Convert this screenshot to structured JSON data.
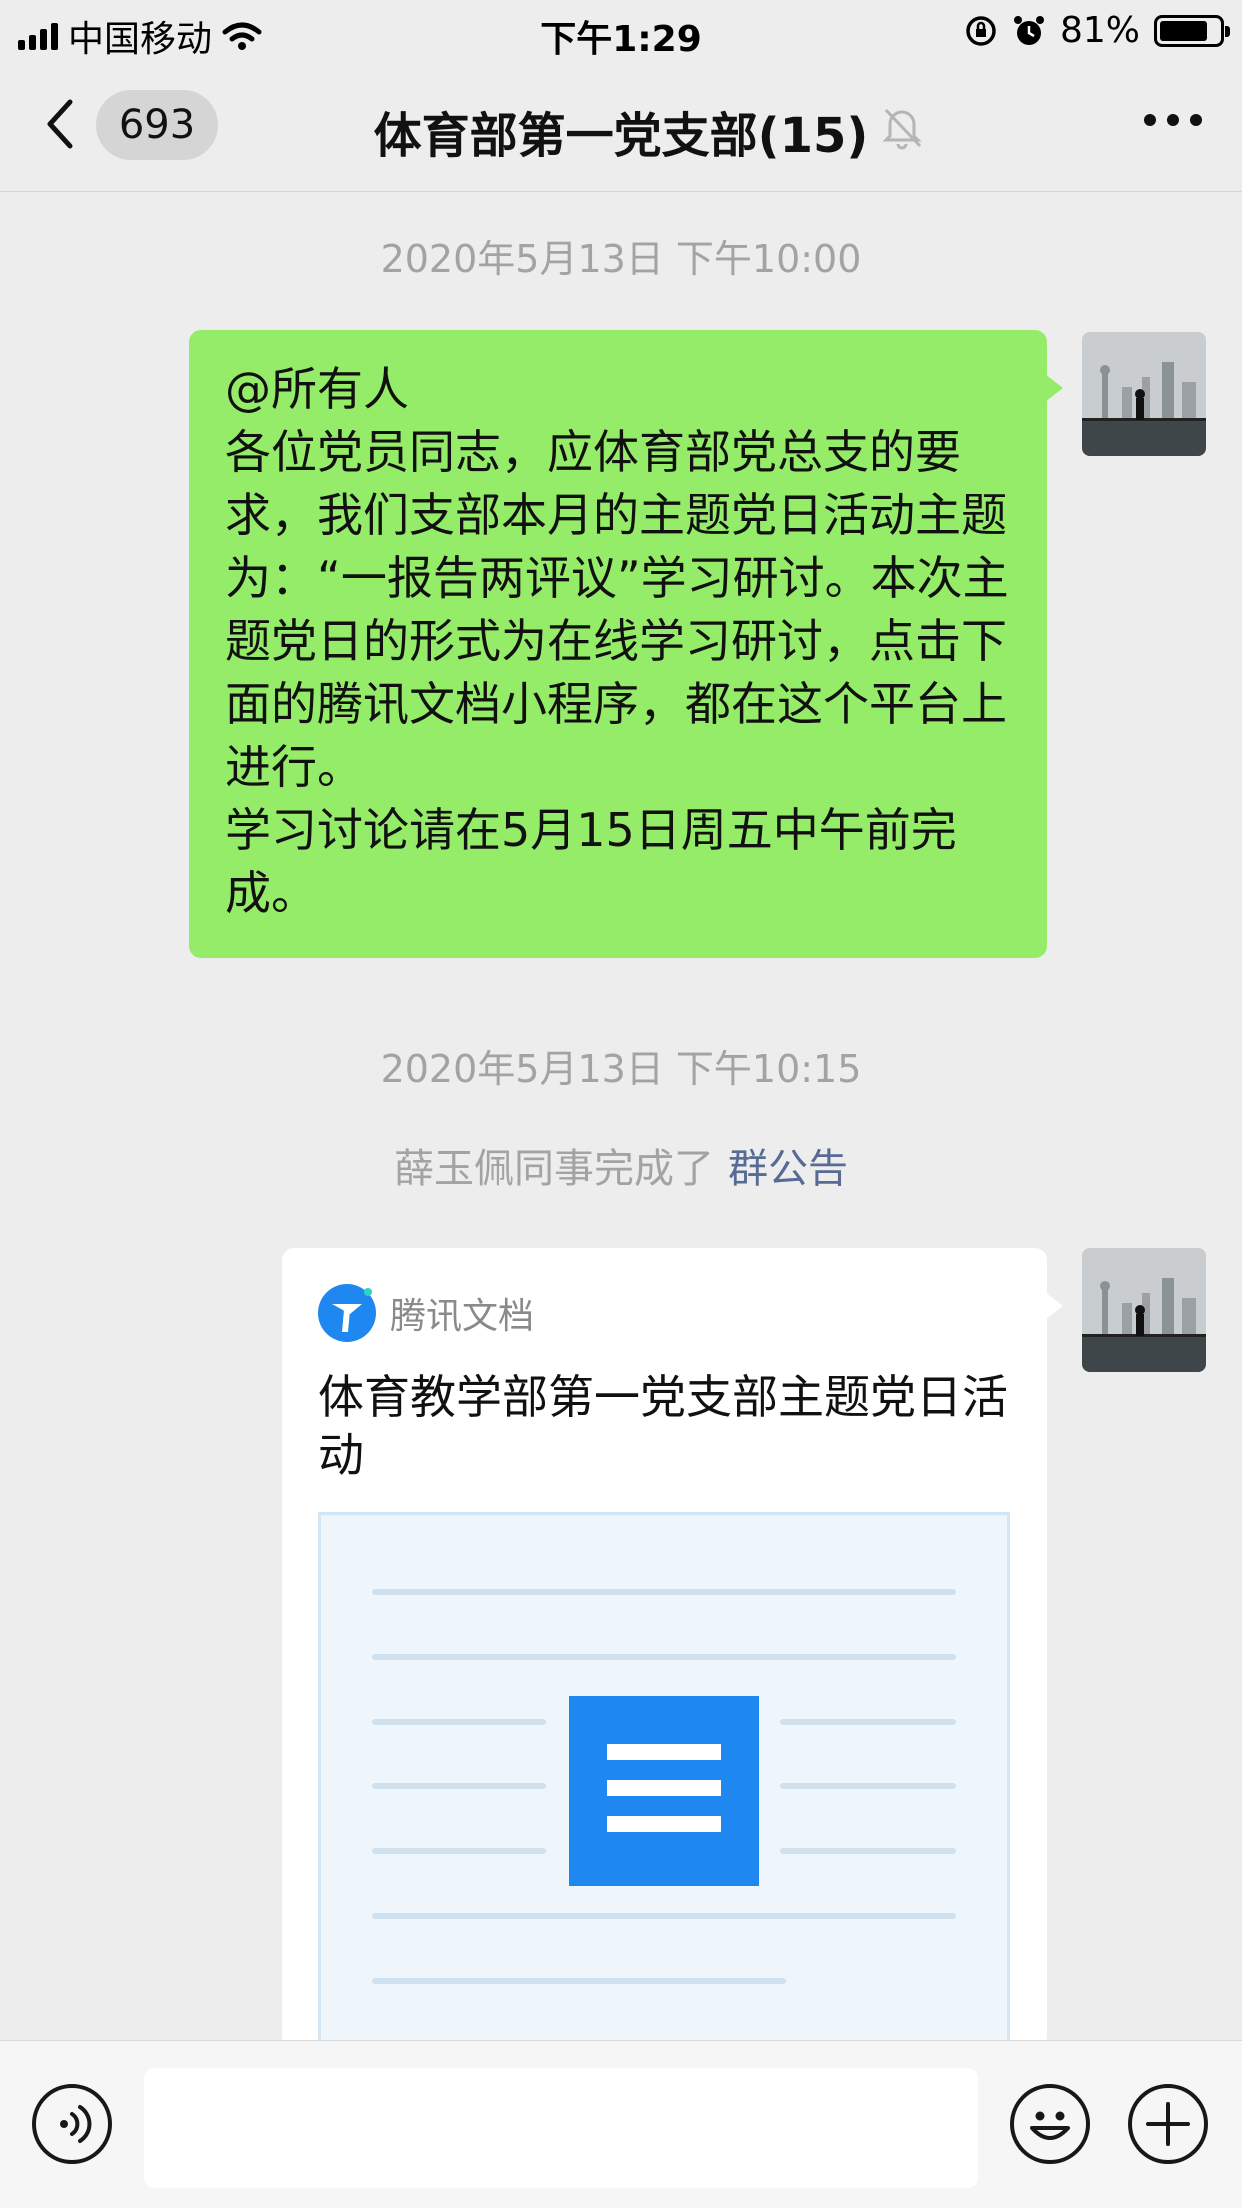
{
  "status_bar": {
    "carrier": "中国移动",
    "time": "下午1:29",
    "battery": "81%",
    "battery_level": 0.81
  },
  "nav": {
    "unread_count": "693",
    "title": "体育部第一党支部(15)",
    "icons": [
      "back-arrow-icon",
      "mute-bell-icon",
      "more-dots-icon"
    ]
  },
  "messages": {
    "timestamp_1": "2020年5月13日 下午10:00",
    "text_message": {
      "lines": [
        "@所有人",
        "各位党员同志，应体育部党总支的要求，我们支部本月的主题党日活动主题为：“一报告两评议”学习研讨。本次主题党日的形式为在线学习研讨，点击下面的腾讯文档小程序，都在这个平台上进行。",
        "学习讨论请在5月15日周五中午前完成。"
      ]
    },
    "timestamp_2": "2020年5月13日 下午10:15",
    "system_notice": {
      "text": "薛玉佩同事完成了",
      "link": "群公告"
    },
    "card": {
      "source": "腾讯文档",
      "title": "体育教学部第一党支部主题党日活动"
    }
  },
  "input_bar": {
    "placeholder": "",
    "icons": [
      "voice-icon",
      "emoji-icon",
      "plus-icon"
    ]
  },
  "colors": {
    "background": "#ededed",
    "bubble_green": "#95ec69",
    "link_blue": "#576b95",
    "doc_blue": "#1e88f0"
  }
}
